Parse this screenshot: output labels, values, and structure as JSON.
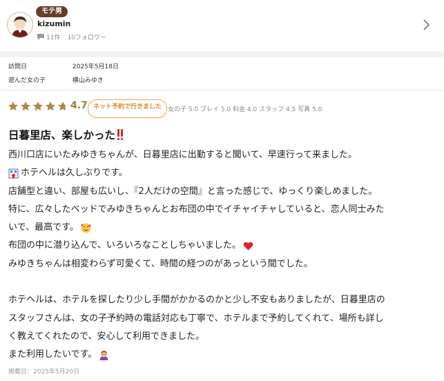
{
  "profile": {
    "badge": "モテ男",
    "username": "kizumin",
    "posts": "11件",
    "followers": "10フォロワー"
  },
  "info": {
    "visit_label": "訪問日",
    "visit_value": "2025年5月18日",
    "girl_label": "遊んだ女の子",
    "girl_value": "横山みゆき"
  },
  "rating": {
    "score": "4.7",
    "stars": 4.7,
    "badge": "ネット予約で行きました",
    "subscores": "女の子 5.0 プレイ 5.0 料金 4.0 スタッフ 4.5 写真 5.0"
  },
  "review": {
    "title": "日暮里店、楽しかった",
    "lines": [
      "西川口店にいたみゆきちゃんが、日暮里店に出勤すると聞いて、早速行って来ました。",
      "ホテヘルは久しぶりです。",
      "店舗型と違い、部屋も広いし、『2人だけの空間』と言った感じで、ゆっくり楽しめました。",
      "特に、広々したベッドでみゆきちゃんとお布団の中でイチャイチャしていると、恋人同士みた",
      "いで、最高です。",
      "布団の中に潜り込んで、いろいろなことしちゃいました。",
      "みゆきちゃんは相変わらず可愛くて、時間の経つのがあっという間でした。",
      "ホテヘルは、ホテルを探したり少し手間がかかるのかと少し不安もありましたが、日暮里店の",
      "スタッフさんは、女の子予約時の電話対応も丁寧で、ホテルまで予約してくれて、場所も詳し",
      "く教えてくれたので、安心して利用できました。",
      "また利用したいです。"
    ],
    "posted": "掲載日：2025年5月20日"
  },
  "colors": {
    "accent": "#f0a24b",
    "badge_bg": "#6b3b2a",
    "star": "#a8894a"
  }
}
